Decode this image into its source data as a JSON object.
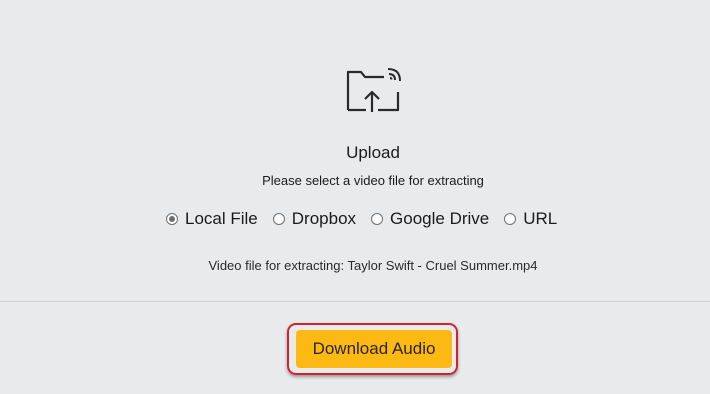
{
  "upload": {
    "icon": "folder-upload-icon",
    "title": "Upload",
    "subtitle": "Please select a video file for extracting"
  },
  "source_options": [
    {
      "label": "Local File",
      "selected": true
    },
    {
      "label": "Dropbox",
      "selected": false
    },
    {
      "label": "Google Drive",
      "selected": false
    },
    {
      "label": "URL",
      "selected": false
    }
  ],
  "selected_file_text": "Video file for extracting: Taylor Swift - Cruel Summer.mp4",
  "download_button": {
    "label": "Download Audio",
    "color": "#fdb913",
    "highlight_color": "#d0232f"
  }
}
